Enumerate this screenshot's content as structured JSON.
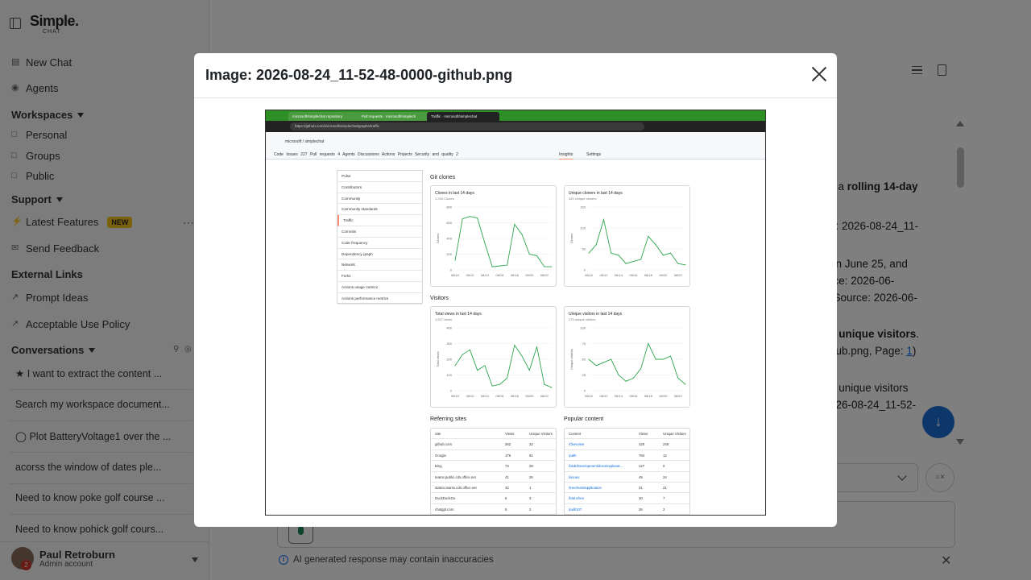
{
  "sidebar": {
    "logo": "Simple.",
    "logo_sub": "CHAT",
    "new_chat": "New Chat",
    "agents": "Agents",
    "workspaces_heading": "Workspaces",
    "workspaces": [
      "Personal",
      "Groups",
      "Public"
    ],
    "support_heading": "Support",
    "latest_features": "Latest Features",
    "new_badge": "NEW",
    "send_feedback": "Send Feedback",
    "external_links_heading": "External Links",
    "prompt_ideas": "Prompt Ideas",
    "acceptable_use": "Acceptable Use Policy",
    "conversations_heading": "Conversations",
    "conversations": [
      "I want to extract the content ...",
      "Search my workspace document...",
      "Plot BatteryVoltage1 over the ...",
      "acorss the window of dates ple...",
      "Need to know poke golf course ...",
      "Need to know pohick golf cours..."
    ],
    "user": {
      "name": "Paul Retroburn",
      "role": "Admin account",
      "badge": "2"
    }
  },
  "chat": {
    "lines": [
      {
        "pre": "s a ",
        "bold": "rolling 14-day",
        "post": ""
      },
      {
        "pre": "",
        "bold": "",
        "post": ""
      },
      {
        "pre": "e: 2026-08-24_11-",
        "bold": "",
        "post": ""
      },
      {
        "pre": "",
        "bold": "",
        "post": ""
      },
      {
        "pre": "on June 25, and",
        "bold": "",
        "post": ""
      },
      {
        "pre": "rce: 2026-06-",
        "bold": "",
        "post": ""
      },
      {
        "pre": "(Source: 2026-06-",
        "bold": "",
        "post": ""
      },
      {
        "pre": "",
        "bold": "",
        "post": ""
      },
      {
        "pre": "",
        "bold": "2 unique visitors",
        "post": "."
      },
      {
        "pre": "hub.png, Page: ",
        "bold": "",
        "post": ""
      },
      {
        "pre": "",
        "bold": "",
        "post": ""
      },
      {
        "pre": "e unique visitors",
        "bold": "",
        "post": ""
      },
      {
        "pre": "026-08-24_11-52-",
        "bold": "",
        "post": ""
      }
    ],
    "page_link": "1",
    "page_close": ")",
    "disclaimer": "AI generated response may contain inaccuracies"
  },
  "modal": {
    "title": "Image: 2026-08-24_11-52-48-0000-github.png"
  },
  "screenshot": {
    "tabs": [
      "microsoft/simplechat repository",
      "Pull requests · microsoft/simplech",
      "Traffic · microsoft/simplechat"
    ],
    "url": "https://github.com/microsoft/simplechat/graphs/traffic",
    "repo": "microsoft  /  simplechat",
    "nav": "Code    Issues 227    Pull requests 4    Agents    Discussions    Actions    Projects    Security and quality 2",
    "insights": "Insights",
    "settings": "Settings",
    "menu": [
      "Pulse",
      "Contributors",
      "Community",
      "Community standards",
      "Traffic",
      "Commits",
      "Code frequency",
      "Dependency graph",
      "Network",
      "Forks",
      "Actions usage metrics",
      "Actions performance metrics"
    ],
    "git_clones": "Git clones",
    "visitors": "Visitors",
    "clones_title": "Clones in last 14 days",
    "clones_sub": "1,234 Clones",
    "unique_cloners_title": "Unique cloners in last 14 days",
    "unique_cloners_sub": "420 Unique cloners",
    "views_title": "Total views in last 14 days",
    "views_sub": "1,527 views",
    "unique_visitors_title": "Unique visitors in last 14 days",
    "unique_visitors_sub": "175 unique visitors",
    "referring_sites": "Referring sites",
    "popular_content": "Popular content",
    "ref_headers": [
      "Site",
      "Views",
      "Unique Visitors"
    ],
    "ref_rows": [
      [
        "github.com",
        "262",
        "32"
      ],
      [
        "Google",
        "176",
        "81"
      ],
      [
        "Bing",
        "73",
        "28"
      ],
      [
        "teams.public.cdn.office.net",
        "41",
        "26"
      ],
      [
        "statics.teams.cdn.office.net",
        "32",
        "1"
      ],
      [
        "DuckDuckGo",
        "5",
        "3"
      ],
      [
        "chatgpt.com",
        "5",
        "2"
      ]
    ],
    "pop_headers": [
      "Content",
      "Views",
      "Unique Visitors"
    ],
    "pop_rows": [
      [
        "/Overview",
        "420",
        "245"
      ],
      [
        "/path",
        "794",
        "12"
      ],
      [
        "/blob/Development/docs/explanat...",
        "127",
        "0"
      ],
      [
        "/issues",
        "49",
        "24"
      ],
      [
        "/tree/main/application",
        "31",
        "21"
      ],
      [
        "/branches",
        "30",
        "7"
      ],
      [
        "/pull/107",
        "26",
        "2"
      ]
    ]
  },
  "chart_data": [
    {
      "type": "line",
      "title": "Clones in last 14 days",
      "x": [
        "08/10",
        "08/11",
        "08/12",
        "08/13",
        "08/14",
        "08/15",
        "08/16",
        "08/17",
        "08/18",
        "08/19",
        "08/20",
        "08/21",
        "08/22",
        "08/23"
      ],
      "xticks": [
        "08/10",
        "08/12",
        "08/14",
        "08/16",
        "08/18",
        "08/20",
        "08/22"
      ],
      "yticks": [
        "0",
        "200",
        "400",
        "600",
        "800"
      ],
      "ylim": [
        0,
        800
      ],
      "values": [
        120,
        650,
        680,
        660,
        340,
        40,
        50,
        60,
        580,
        450,
        200,
        180,
        40,
        40
      ],
      "ylabel": "Clones",
      "color": "#2da44e"
    },
    {
      "type": "line",
      "title": "Unique cloners in last 14 days",
      "x": [
        "08/10",
        "08/11",
        "08/12",
        "08/13",
        "08/14",
        "08/15",
        "08/16",
        "08/17",
        "08/18",
        "08/19",
        "08/20",
        "08/21",
        "08/22",
        "08/23"
      ],
      "xticks": [
        "08/10",
        "08/12",
        "08/14",
        "08/16",
        "08/18",
        "08/20",
        "08/22"
      ],
      "yticks": [
        "0",
        "50",
        "100",
        "150"
      ],
      "ylim": [
        0,
        150
      ],
      "values": [
        40,
        60,
        120,
        40,
        35,
        15,
        20,
        25,
        80,
        60,
        35,
        40,
        15,
        12
      ],
      "ylabel": "Clones",
      "color": "#2da44e"
    },
    {
      "type": "line",
      "title": "Total views in last 14 days",
      "x": [
        "08/10",
        "08/11",
        "08/12",
        "08/13",
        "08/14",
        "08/15",
        "08/16",
        "08/17",
        "08/18",
        "08/19",
        "08/20",
        "08/21",
        "08/22",
        "08/23"
      ],
      "xticks": [
        "08/10",
        "08/12",
        "08/14",
        "08/16",
        "08/18",
        "08/20",
        "08/22"
      ],
      "yticks": [
        "0",
        "100",
        "200",
        "300",
        "400"
      ],
      "ylim": [
        0,
        400
      ],
      "values": [
        160,
        230,
        260,
        130,
        160,
        30,
        40,
        80,
        290,
        220,
        130,
        280,
        40,
        20
      ],
      "ylabel": "Total views",
      "color": "#2da44e"
    },
    {
      "type": "line",
      "title": "Unique visitors in last 14 days",
      "x": [
        "08/10",
        "08/11",
        "08/12",
        "08/13",
        "08/14",
        "08/15",
        "08/16",
        "08/17",
        "08/18",
        "08/19",
        "08/20",
        "08/21",
        "08/22",
        "08/23"
      ],
      "xticks": [
        "08/10",
        "08/12",
        "08/14",
        "08/16",
        "08/18",
        "08/20",
        "08/22"
      ],
      "yticks": [
        "0",
        "25",
        "50",
        "75",
        "100"
      ],
      "ylim": [
        0,
        100
      ],
      "values": [
        50,
        40,
        45,
        50,
        25,
        15,
        20,
        35,
        75,
        50,
        50,
        55,
        20,
        10
      ],
      "ylabel": "Unique visitors",
      "color": "#2da44e"
    }
  ]
}
